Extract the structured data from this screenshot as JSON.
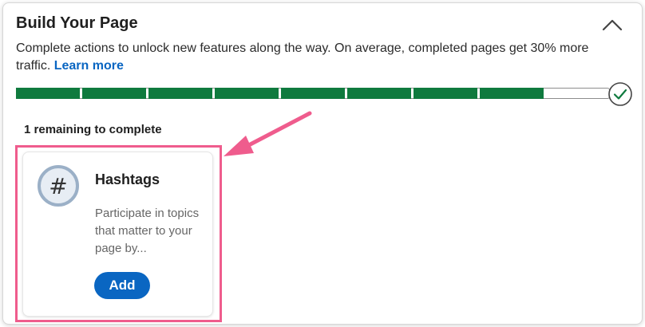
{
  "header": {
    "title": "Build Your Page",
    "collapse_icon": "chevron-up-icon"
  },
  "description": {
    "text": "Complete actions to unlock new features along the way. On average, completed pages get 30% more traffic.",
    "link_text": "Learn more"
  },
  "progress": {
    "completed_steps": 8,
    "total_steps": 9,
    "complete_icon": "checkmark-circle-icon",
    "fill_color": "#0f7a3e"
  },
  "remaining_text": "1 remaining to complete",
  "card": {
    "icon": "hashtag-icon",
    "icon_glyph": "#",
    "title": "Hashtags",
    "description": "Participate in topics that matter to your page by...",
    "button_label": "Add",
    "highlight_color": "#ef5c8d",
    "accent_color": "#0a66c2"
  },
  "annotation": {
    "arrow_icon": "pointer-arrow-icon",
    "color": "#ef5c8d"
  }
}
